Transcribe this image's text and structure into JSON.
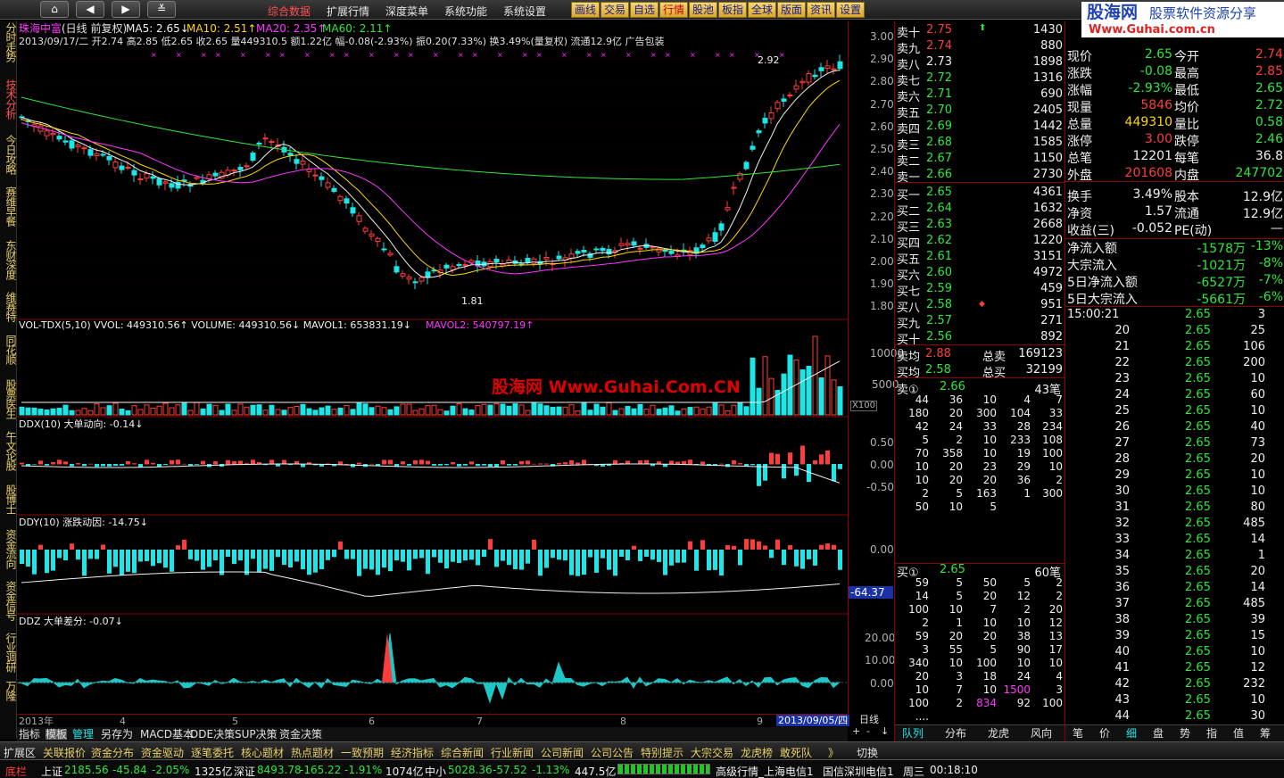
{
  "topbar": {
    "nav_buttons": [
      "home-icon",
      "back-icon",
      "forward-icon",
      "menu-down-icon"
    ],
    "menus": [
      "综合数据",
      "扩展行情",
      "深度菜单",
      "系统功能",
      "系统设置"
    ],
    "tools": [
      "画线",
      "交易",
      "自选",
      "行情",
      "股池",
      "板指",
      "全球",
      "版面",
      "资讯",
      "设置"
    ],
    "logo_main": "股海网",
    "logo_sub": "股票软件资源分享",
    "logo_url": "Www.Guhai.com.cn"
  },
  "sidebar": [
    "分时走势",
    "技术分析",
    "今日攻略",
    "赛维早餐",
    "东财深度",
    "维赛特",
    "同花顺",
    "股票医生",
    "午文论股",
    "股博士",
    "资金流向",
    "资金信号",
    "行业调研",
    "万隆"
  ],
  "chart": {
    "stock_name": "珠海中富",
    "period": "(日线 前复权)",
    "ma5": "MA5: 2.65↓",
    "ma10": "MA10: 2.51↑",
    "ma20": "MA20: 2.35↑",
    "ma60": "MA60: 2.11↑",
    "info_line": "2013/09/17/二 开2.74 高2.85 低2.65 收2.65 量449310.5 额1.22亿 幅-0.08(-2.93%) 振0.20(7.33%) 换3.49%(量复权) 流通12.9亿 广告包装",
    "high_mark": "2.92",
    "low_mark": "1.81",
    "price_axis": [
      "3.00",
      "2.90",
      "2.80",
      "2.70",
      "2.60",
      "2.50",
      "2.40",
      "2.30",
      "2.20",
      "2.10",
      "2.00",
      "1.90",
      "1.80"
    ],
    "vol_title": "VOL-TDX(5,10) VVOL: 449310.56↑  VOLUME: 449310.56↓  MAVOL1: 653831.19↓",
    "mavol2": "MAVOL2: 540797.19↑",
    "vol_axis": [
      "10000",
      "5000"
    ],
    "vol_unit": "X100",
    "watermark": "股海网 Www.Guhai.Com.CN",
    "ddx_title": "DDX(10) 大单动向: -0.14↓",
    "ddx_axis": [
      "0.50",
      "0.00",
      "-0.50"
    ],
    "ddy_title": "DDY(10) 涨跌动因: -14.75↓",
    "ddy_axis": [
      "0.00"
    ],
    "ddy_value_box": "-64.37",
    "ddz_title": "DDZ 大单差分: -0.07↓",
    "ddz_axis": [
      "20.00",
      "10.00",
      "0.00"
    ],
    "time_axis": [
      "2013年",
      "4",
      "5",
      "6",
      "7",
      "8",
      "9"
    ],
    "date_box": "2013/09/05/四",
    "period_label": "日线",
    "zoom_buttons": [
      "+",
      "-",
      "↓"
    ]
  },
  "book": {
    "asks": [
      {
        "label": "卖十",
        "price": "2.75",
        "vol": "1430",
        "flag": "up"
      },
      {
        "label": "卖九",
        "price": "2.74",
        "vol": "880"
      },
      {
        "label": "卖八",
        "price": "2.73",
        "vol": "1898",
        "white": true
      },
      {
        "label": "卖七",
        "price": "2.72",
        "vol": "1316"
      },
      {
        "label": "卖六",
        "price": "2.71",
        "vol": "690"
      },
      {
        "label": "卖五",
        "price": "2.70",
        "vol": "2405"
      },
      {
        "label": "卖四",
        "price": "2.69",
        "vol": "1442"
      },
      {
        "label": "卖三",
        "price": "2.68",
        "vol": "1585"
      },
      {
        "label": "卖二",
        "price": "2.67",
        "vol": "1150"
      },
      {
        "label": "卖一",
        "price": "2.66",
        "vol": "2730"
      }
    ],
    "bids": [
      {
        "label": "买一",
        "price": "2.65",
        "vol": "4361"
      },
      {
        "label": "买二",
        "price": "2.64",
        "vol": "1632"
      },
      {
        "label": "买三",
        "price": "2.63",
        "vol": "2668"
      },
      {
        "label": "买四",
        "price": "2.62",
        "vol": "1220"
      },
      {
        "label": "买五",
        "price": "2.61",
        "vol": "3151"
      },
      {
        "label": "买六",
        "price": "2.60",
        "vol": "4972"
      },
      {
        "label": "买七",
        "price": "2.59",
        "vol": "459"
      },
      {
        "label": "买八",
        "price": "2.58",
        "vol": "951",
        "flag": "dot"
      },
      {
        "label": "买九",
        "price": "2.57",
        "vol": "271"
      },
      {
        "label": "买十",
        "price": "2.56",
        "vol": "892"
      }
    ],
    "avg_sell_label": "卖均",
    "avg_sell": "2.88",
    "total_sell_label": "总卖",
    "total_sell": "169123",
    "avg_buy_label": "买均",
    "avg_buy": "2.58",
    "total_buy_label": "总买",
    "total_buy": "32199",
    "sell1_queue": {
      "label": "卖①",
      "price": "2.66",
      "count": "43笔",
      "rows": [
        [
          "44",
          "36",
          "10",
          "4",
          "7"
        ],
        [
          "180",
          "20",
          "300",
          "104",
          "33"
        ],
        [
          "42",
          "24",
          "33",
          "28",
          "234"
        ],
        [
          "5",
          "2",
          "10",
          "233",
          "108"
        ],
        [
          "70",
          "358",
          "10",
          "19",
          "100"
        ],
        [
          "10",
          "20",
          "23",
          "29",
          "10"
        ],
        [
          "10",
          "20",
          "20",
          "36",
          "2"
        ],
        [
          "2",
          "5",
          "163",
          "1",
          "300"
        ],
        [
          "50",
          "10",
          "5",
          "",
          ""
        ]
      ]
    },
    "buy1_queue": {
      "label": "买①",
      "price": "2.65",
      "count": "60笔",
      "rows": [
        [
          "59",
          "5",
          "50",
          "5",
          "2"
        ],
        [
          "14",
          "5",
          "20",
          "12",
          "2"
        ],
        [
          "100",
          "10",
          "7",
          "2",
          "20"
        ],
        [
          "2",
          "1",
          "10",
          "10",
          "12"
        ],
        [
          "59",
          "20",
          "20",
          "38",
          "13"
        ],
        [
          "3",
          "55",
          "5",
          "90",
          "17"
        ],
        [
          "340",
          "10",
          "100",
          "10",
          "10"
        ],
        [
          "20",
          "3",
          "18",
          "24",
          "4"
        ],
        [
          "10",
          "7",
          "10",
          "1500",
          "3"
        ],
        [
          "100",
          "2",
          "834",
          "92",
          "100"
        ],
        [
          "....",
          "",
          "",
          "",
          ""
        ]
      ]
    },
    "tabs": [
      "队列",
      "分布",
      "龙虎",
      "风向"
    ]
  },
  "quote": {
    "rows": [
      {
        "l": "现价",
        "v": "2.65",
        "vc": "grn",
        "l2": "今开",
        "v2": "2.74",
        "v2c": "red"
      },
      {
        "l": "涨跌",
        "v": "-0.08",
        "vc": "grn",
        "l2": "最高",
        "v2": "2.85",
        "v2c": "red"
      },
      {
        "l": "涨幅",
        "v": "-2.93%",
        "vc": "grn",
        "l2": "最低",
        "v2": "2.65",
        "v2c": "grn"
      },
      {
        "l": "现量",
        "v": "5846",
        "vc": "red",
        "l2": "均价",
        "v2": "2.72",
        "v2c": "grn"
      },
      {
        "l": "总量",
        "v": "449310",
        "vc": "yel",
        "l2": "量比",
        "v2": "0.58",
        "v2c": "grn"
      },
      {
        "l": "涨停",
        "v": "3.00",
        "vc": "red",
        "l2": "跌停",
        "v2": "2.46",
        "v2c": "grn"
      },
      {
        "l": "总笔",
        "v": "12201",
        "vc": "wht",
        "l2": "每笔",
        "v2": "36.8",
        "v2c": "wht"
      },
      {
        "l": "外盘",
        "v": "201608",
        "vc": "red",
        "l2": "内盘",
        "v2": "247702",
        "v2c": "grn"
      },
      {
        "l": "换手",
        "v": "3.49%",
        "vc": "wht",
        "l2": "股本",
        "v2": "12.9亿",
        "v2c": "wht"
      },
      {
        "l": "净资",
        "v": "1.57",
        "vc": "wht",
        "l2": "流通",
        "v2": "12.9亿",
        "v2c": "wht"
      },
      {
        "l": "收益(三)",
        "v": "-0.052",
        "vc": "wht",
        "l2": "PE(动)",
        "v2": "—",
        "v2c": "wht"
      }
    ],
    "flows": [
      {
        "l": "净流入额",
        "v": "-1578万",
        "p": "-13%"
      },
      {
        "l": "大宗流入",
        "v": "-1021万",
        "p": "-8%"
      },
      {
        "l": "5日净流入额",
        "v": "-6527万",
        "p": "-7%"
      },
      {
        "l": "5日大宗流入",
        "v": "-5661万",
        "p": "-6%"
      }
    ],
    "ticks_first_time": "15:00:21",
    "ticks": [
      [
        "",
        "2.65",
        "3"
      ],
      [
        "20",
        "2.65",
        "25"
      ],
      [
        "21",
        "2.65",
        "106"
      ],
      [
        "22",
        "2.65",
        "200"
      ],
      [
        "23",
        "2.65",
        "10"
      ],
      [
        "24",
        "2.65",
        "60"
      ],
      [
        "25",
        "2.65",
        "10"
      ],
      [
        "26",
        "2.65",
        "40"
      ],
      [
        "27",
        "2.65",
        "73"
      ],
      [
        "28",
        "2.65",
        "20"
      ],
      [
        "29",
        "2.65",
        "10"
      ],
      [
        "30",
        "2.65",
        "10"
      ],
      [
        "31",
        "2.65",
        "80"
      ],
      [
        "32",
        "2.65",
        "485"
      ],
      [
        "33",
        "2.65",
        "14"
      ],
      [
        "34",
        "2.65",
        "1"
      ],
      [
        "35",
        "2.65",
        "20"
      ],
      [
        "36",
        "2.65",
        "14"
      ],
      [
        "37",
        "2.65",
        "485"
      ],
      [
        "38",
        "2.65",
        "39"
      ],
      [
        "39",
        "2.65",
        "15"
      ],
      [
        "40",
        "2.65",
        "10"
      ],
      [
        "41",
        "2.65",
        "12"
      ],
      [
        "42",
        "2.65",
        "232"
      ],
      [
        "43",
        "2.65",
        "10"
      ],
      [
        "44",
        "2.65",
        "30"
      ],
      [
        "45",
        "2.65",
        "12"
      ]
    ],
    "tabs": [
      "笔",
      "价",
      "细",
      "盘",
      "势",
      "指",
      "值",
      "筹"
    ]
  },
  "bottom_tabs": [
    "指标",
    "模板",
    "管理",
    "另存为",
    "MACD基本",
    "DDE决策",
    "SUP决策",
    "资金决策"
  ],
  "bar1": {
    "items": [
      "扩展区",
      "关联报价",
      "资金分布",
      "资金驱动",
      "逐笔委托",
      "核心题材",
      "热点题材",
      "一致预期",
      "经济指标",
      "综合新闻",
      "行业新闻",
      "公司新闻",
      "公司公告",
      "特别提示",
      "大宗交易",
      "龙虎榜",
      "敢死队"
    ],
    "more": "》",
    "switch": "切换"
  },
  "bar2": {
    "label": "底栏",
    "sh_name": "上证",
    "sh_val": "2185.56",
    "sh_chg": "-45.84",
    "sh_pct": "-2.05%",
    "sh_amt": "1325亿",
    "sz_name": "深证",
    "sz_val": "8493.78",
    "sz_chg": "-165.22",
    "sz_pct": "-1.91%",
    "sz_amt": "1074亿",
    "zx_name": "中小",
    "zx_val": "5028.36",
    "zx_chg": "-57.52",
    "zx_pct": "-1.13%",
    "zx_amt": "447.5亿",
    "server1": "高级行情_上海电信1",
    "server2": "国信深圳电信1",
    "weekday": "周三",
    "clock": "00:18:10"
  }
}
